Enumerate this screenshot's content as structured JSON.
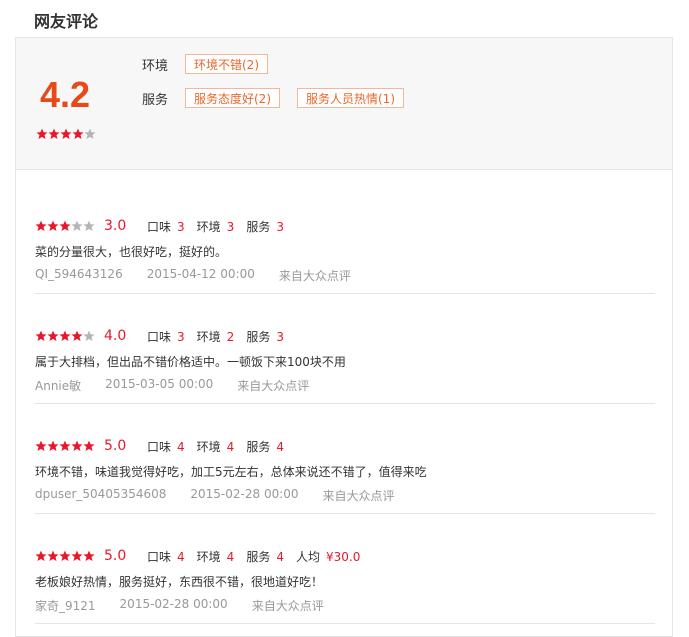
{
  "title": "网友评论",
  "summary": {
    "score": "4.2",
    "stars": [
      1,
      1,
      1,
      1,
      0
    ],
    "environment_label": "环境",
    "environment_tags": [
      "环境不错(2)"
    ],
    "service_label": "服务",
    "service_tags": [
      "服务态度好(2)",
      "服务人员热情(1)"
    ]
  },
  "colors": {
    "accent": "#e8182c",
    "score": "#e64a19",
    "tag": "#e8682c",
    "star_off": "#b5b5b5"
  },
  "reviews": [
    {
      "stars": [
        1,
        1,
        1,
        0,
        0
      ],
      "score": "3.0",
      "taste_label": "口味",
      "taste": "3",
      "env_label": "环境",
      "env": "3",
      "service_label": "服务",
      "service": "3",
      "text": "菜的分量很大，也很好吃，挺好的。",
      "user": "QI_594643126",
      "date": "2015-04-12 00:00",
      "source": "来自大众点评"
    },
    {
      "stars": [
        1,
        1,
        1,
        1,
        0
      ],
      "score": "4.0",
      "taste_label": "口味",
      "taste": "3",
      "env_label": "环境",
      "env": "2",
      "service_label": "服务",
      "service": "3",
      "text": "属于大排档，但出品不错价格适中。一顿饭下来100块不用",
      "user": "Annie敏",
      "date": "2015-03-05 00:00",
      "source": "来自大众点评"
    },
    {
      "stars": [
        1,
        1,
        1,
        1,
        1
      ],
      "score": "5.0",
      "taste_label": "口味",
      "taste": "4",
      "env_label": "环境",
      "env": "4",
      "service_label": "服务",
      "service": "4",
      "text": "环境不错，味道我觉得好吃，加工5元左右，总体来说还不错了，值得来吃",
      "user": "dpuser_50405354608",
      "date": "2015-02-28 00:00",
      "source": "来自大众点评"
    },
    {
      "stars": [
        1,
        1,
        1,
        1,
        1
      ],
      "score": "5.0",
      "taste_label": "口味",
      "taste": "4",
      "env_label": "环境",
      "env": "4",
      "service_label": "服务",
      "service": "4",
      "price_label": "人均",
      "price": "¥30.0",
      "text": "老板娘好热情，服务挺好，东西很不错，很地道好吃！",
      "user": "家奇_9121",
      "date": "2015-02-28 00:00",
      "source": "来自大众点评"
    }
  ]
}
